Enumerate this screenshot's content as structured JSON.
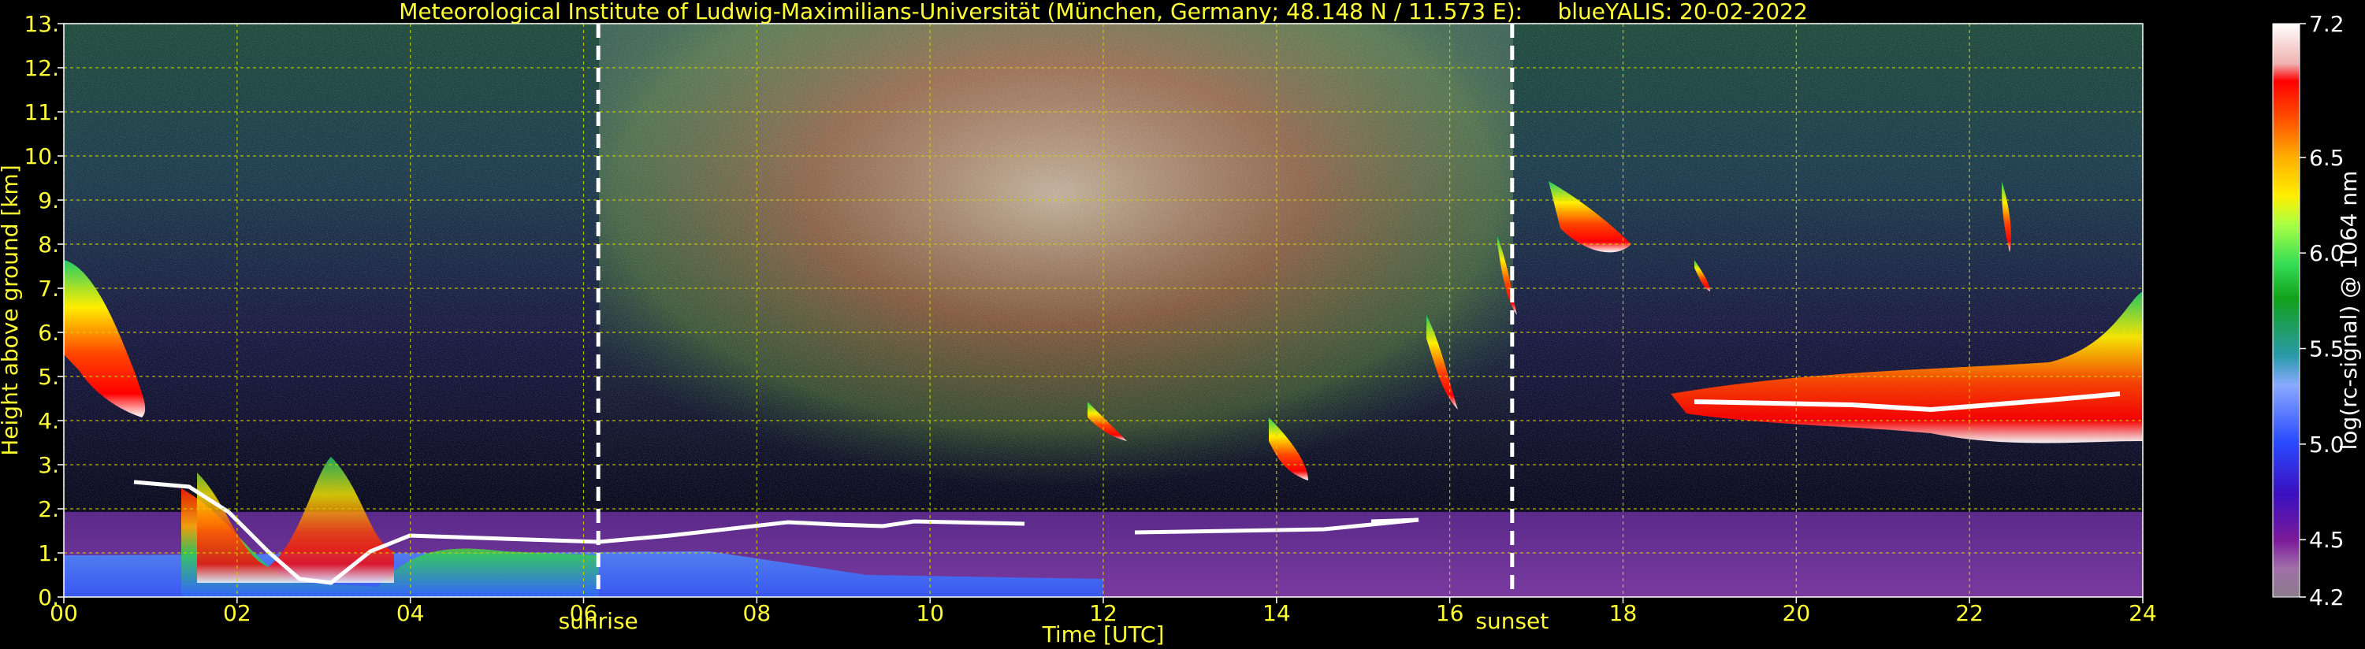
{
  "chart_data": {
    "type": "heatmap",
    "title": "Meteorological Institute of Ludwig-Maximilians-Universität (München, Germany; 48.148 N / 11.573 E):     blueYALIS: 20-02-2022",
    "xlabel": "Time [UTC]",
    "ylabel": "Height above ground [km]",
    "xlim": [
      0,
      24
    ],
    "ylim": [
      0,
      13
    ],
    "x_ticks": [
      "00",
      "02",
      "04",
      "06",
      "08",
      "10",
      "12",
      "14",
      "16",
      "18",
      "20",
      "22",
      "24"
    ],
    "y_ticks": [
      "0.",
      "1.",
      "2.",
      "3.",
      "4.",
      "5.",
      "6.",
      "7.",
      "8.",
      "9.",
      "10.",
      "11.",
      "12.",
      "13."
    ],
    "grid": true,
    "annotations": [
      {
        "label": "sunrise",
        "x": 6.17
      },
      {
        "label": "sunset",
        "x": 16.72
      }
    ],
    "colorbar": {
      "label": "log(rc-signal) @ 1064 nm",
      "range": [
        4.2,
        7.2
      ],
      "ticks": [
        "4.2",
        "4.5",
        "5.0",
        "5.5",
        "6.0",
        "6.5",
        "7.2"
      ],
      "tick_values": [
        4.2,
        4.5,
        5.0,
        5.5,
        6.0,
        6.5,
        7.2
      ]
    },
    "colors": {
      "text": "#ffff33",
      "grid": "#d4d400",
      "background": "#000000",
      "colorbar_label": "#ffffff"
    }
  }
}
